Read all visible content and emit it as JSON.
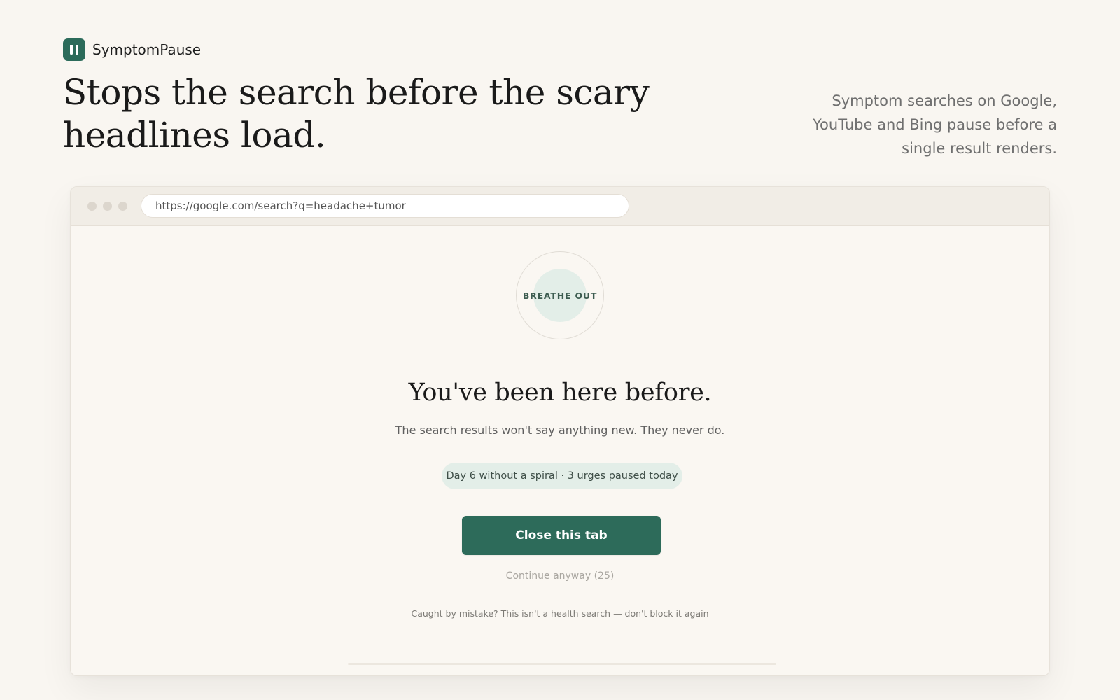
{
  "brand": {
    "name": "SymptomPause",
    "logo_icon": "pause-icon",
    "accent_color": "#2c6b5a"
  },
  "hero": {
    "headline": "Stops the search before the scary headlines load.",
    "tagline": "Symptom searches on Google, YouTube and Bing pause before a single result renders."
  },
  "browser": {
    "url": "https://google.com/search?q=headache+tumor",
    "window_dots": [
      "close-dot",
      "minimize-dot",
      "maximize-dot"
    ]
  },
  "interstitial": {
    "breathe_label": "BREATHE OUT",
    "title": "You've been here before.",
    "subtitle": "The search results won't say anything new. They never do.",
    "streak": "Day 6 without a spiral · 3 urges paused today",
    "close_button": "Close this tab",
    "continue_link": "Continue anyway (25)",
    "mistake_link": "Caught by mistake? This isn't a health search — don't block it again"
  }
}
